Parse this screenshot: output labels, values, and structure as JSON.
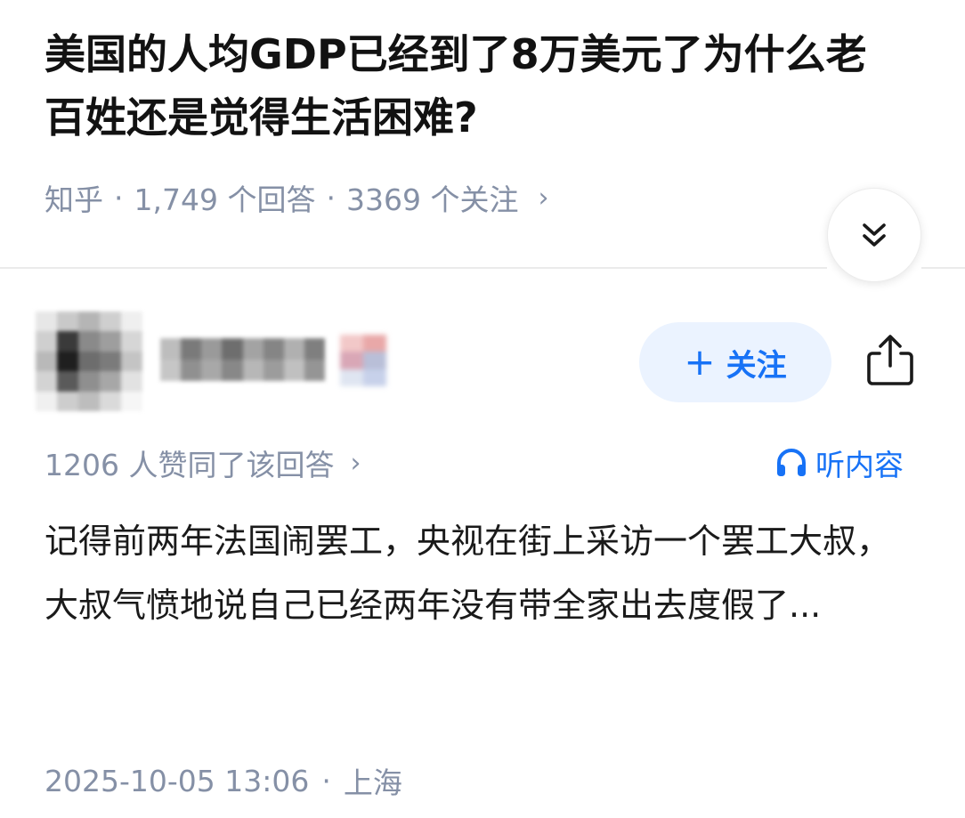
{
  "question": {
    "title": "美国的人均GDP已经到了8万美元了为什么老百姓还是觉得生活困难?",
    "source": "知乎",
    "answer_count": "1,749 个回答",
    "follow_count": "3369 个关注",
    "separator": "·",
    "chevron": "›"
  },
  "collapse": {
    "icon": "double-chevron-down-icon"
  },
  "author": {
    "follow_plus": "+",
    "follow_label": "关注",
    "share_icon": "share-icon"
  },
  "answer": {
    "vote_text": "1206 人赞同了该回答",
    "chevron": "›",
    "listen_label": "听内容",
    "listen_icon": "headphones-icon",
    "excerpt": "记得前两年法国闹罢工，央视在街上采访一个罢工大叔，大叔气愤地说自己已经两年没有带全家出去度假了...",
    "date": "2025-10-05 13:06",
    "separator": "·",
    "location": "上海"
  },
  "colors": {
    "accent": "#1772f6",
    "follow_bg": "#ebf3ff",
    "meta_gray": "#8590a6",
    "title": "#121212"
  }
}
